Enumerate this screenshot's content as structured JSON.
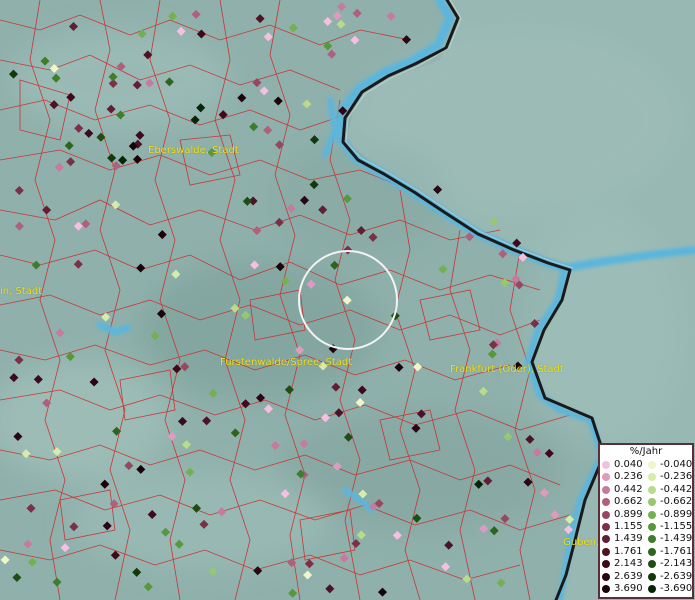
{
  "places": [
    {
      "name": "Eberswalde, Stadt"
    },
    {
      "name": "in, Stadt"
    },
    {
      "name": "Fürstenwalde/Spree, Stadt"
    },
    {
      "name": "Frankfurt (Oder), Stadt"
    },
    {
      "name": "Guben,"
    }
  ],
  "legend": {
    "title": "%/Jahr",
    "positive": [
      {
        "label": "0.040",
        "color": "#f5c0e0"
      },
      {
        "label": "0.236",
        "color": "#e09ac0"
      },
      {
        "label": "0.442",
        "color": "#c87a9e"
      },
      {
        "label": "0.662",
        "color": "#b0607e"
      },
      {
        "label": "0.899",
        "color": "#964862"
      },
      {
        "label": "1.155",
        "color": "#7c3048"
      },
      {
        "label": "1.439",
        "color": "#641e34"
      },
      {
        "label": "1.761",
        "color": "#4e1226"
      },
      {
        "label": "2.143",
        "color": "#3c0a1c"
      },
      {
        "label": "2.639",
        "color": "#2a0512"
      },
      {
        "label": "3.690",
        "color": "#1a020a"
      }
    ],
    "negative": [
      {
        "label": "-0.040",
        "color": "#f0f6c8"
      },
      {
        "label": "-0.236",
        "color": "#d6ecaa"
      },
      {
        "label": "-0.442",
        "color": "#b8dc8c"
      },
      {
        "label": "-0.662",
        "color": "#96c870"
      },
      {
        "label": "-0.899",
        "color": "#74b052"
      },
      {
        "label": "-1.155",
        "color": "#56983c"
      },
      {
        "label": "-1.439",
        "color": "#3e7e2a"
      },
      {
        "label": "-1.761",
        "color": "#2c661e"
      },
      {
        "label": "-2.143",
        "color": "#1e4e14"
      },
      {
        "label": "-2.639",
        "color": "#12380c"
      },
      {
        "label": "-3.690",
        "color": "#082406"
      }
    ]
  },
  "colors": {
    "background": "#8fb0ab",
    "boundary_lines": "#cc2a2a",
    "river": "#5cb6dc",
    "national_border": "#1a1a1a",
    "focus_ring": "#f3f3f3",
    "label_text": "#f2e21b"
  }
}
